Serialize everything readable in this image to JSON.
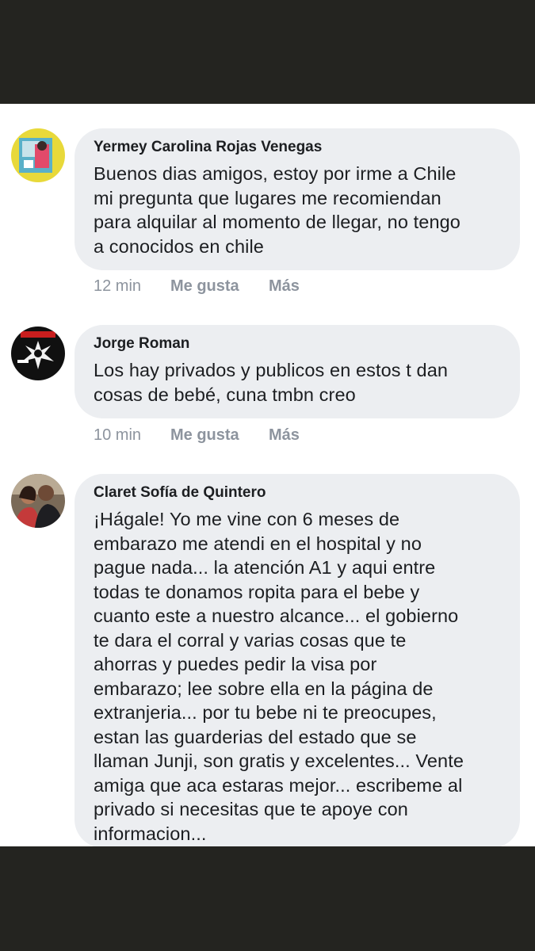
{
  "comments": [
    {
      "author": "Yermey Carolina Rojas Venegas",
      "text": "Buenos dias amigos, estoy por irme a Chile\nmi pregunta que lugares me recomiendan\npara alquilar al momento de llegar, no tengo\na conocidos en chile",
      "time": "12 min",
      "like_label": "Me gusta",
      "more_label": "Más"
    },
    {
      "author": "Jorge Roman",
      "text": "Los hay privados y publicos en estos t dan\ncosas de bebé, cuna tmbn creo",
      "time": "10 min",
      "like_label": "Me gusta",
      "more_label": "Más"
    },
    {
      "author": "Claret Sofía de Quintero",
      "text": "¡Hágale! Yo me vine con 6 meses de\nembarazo me atendi en el hospital y no\npague nada... la atención A1 y aqui entre\ntodas te donamos ropita para el bebe y\ncuanto este a nuestro alcance... el gobierno\nte dara el corral y varias cosas que te\nahorras y puedes pedir la visa por\nembarazo; lee sobre ella en la página de\nextranjeria... por tu bebe ni te preocupes,\nestan las guarderias del estado que se\nllaman Junji, son gratis y excelentes... Vente\namiga que aca estaras mejor... escribeme al\nprivado si necesitas que te apoye con\ninformacion..."
    }
  ]
}
